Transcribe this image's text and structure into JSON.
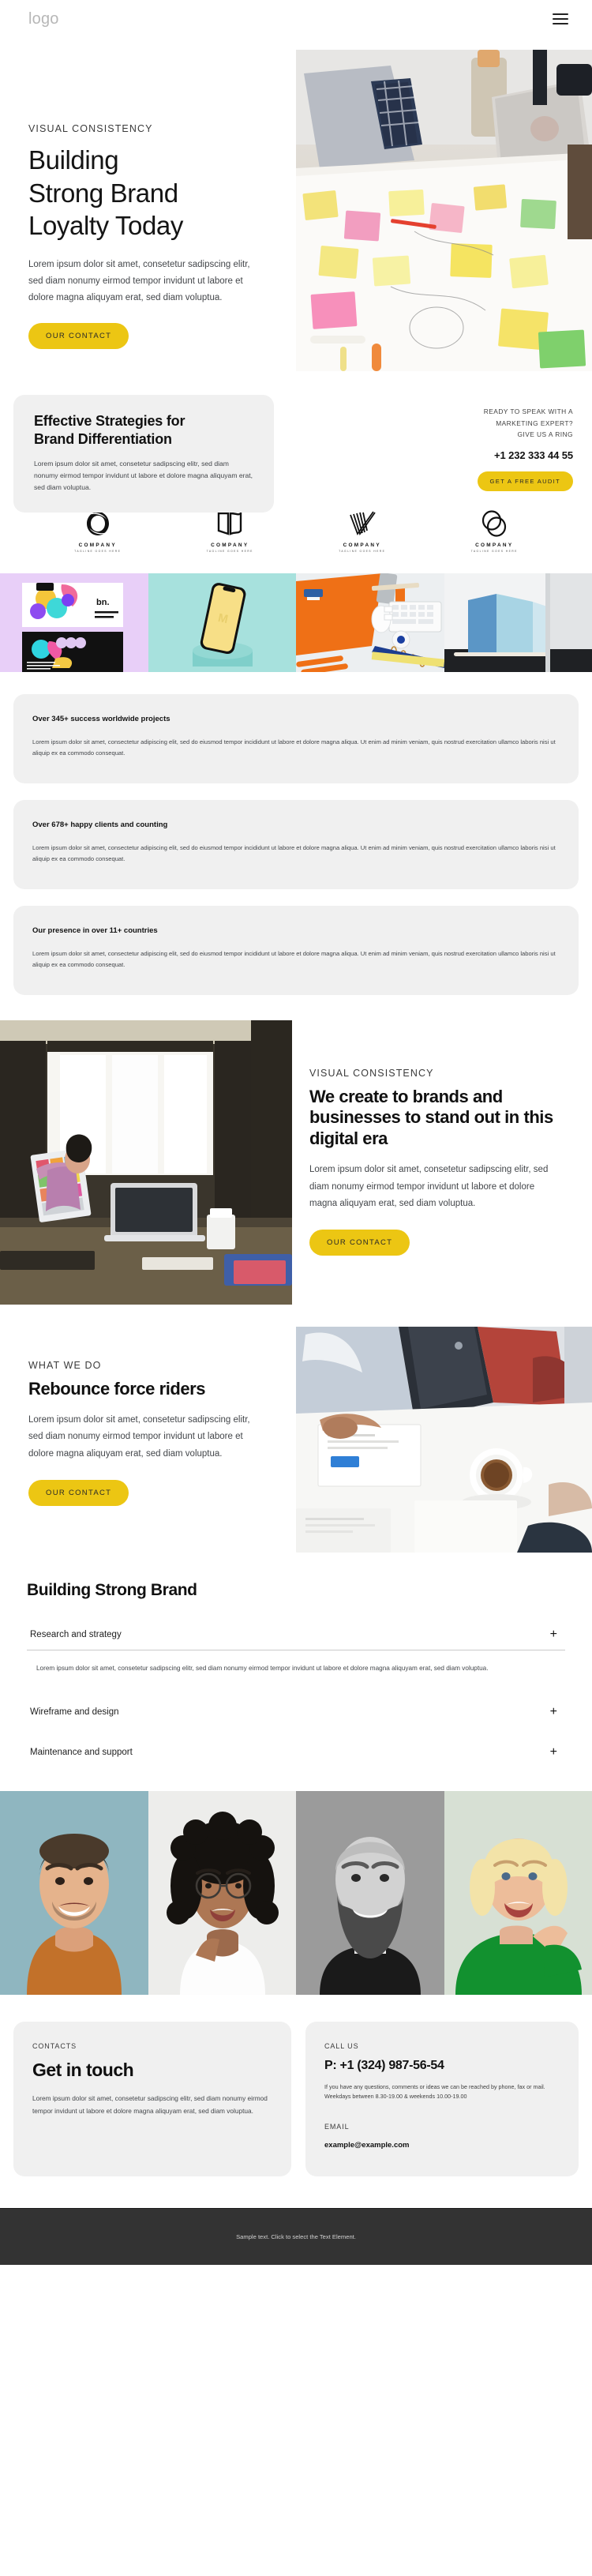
{
  "header": {
    "logo": "logo",
    "menu_icon": "hamburger-menu-icon"
  },
  "hero": {
    "eyebrow": "VISUAL CONSISTENCY",
    "title_line1": "Building",
    "title_line2": "Strong Brand",
    "title_line3": "Loyalty Today",
    "body": "Lorem ipsum dolor sit amet, consetetur sadipscing elitr, sed diam nonumy eirmod tempor invidunt ut labore et dolore magna aliquyam erat, sed diam voluptua.",
    "cta": "OUR CONTACT",
    "image_alt": "team-brainstorming-sticky-notes-photo"
  },
  "strategies": {
    "title_line1": "Effective Strategies for",
    "title_line2": "Brand Differentiation",
    "body": "Lorem ipsum dolor sit amet, consetetur sadipscing elitr, sed diam nonumy eirmod tempor invidunt ut labore et dolore magna aliquyam erat, sed diam voluptua.",
    "side_label_line1": "READY TO SPEAK WITH A",
    "side_label_line2": "MARKETING EXPERT?",
    "side_label_line3": "GIVE US A RING",
    "phone": "+1 232 333 44 55",
    "cta": "GET A FREE AUDIT"
  },
  "clients": [
    {
      "name": "COMPANY",
      "tagline": "TAGLINE GOES HERE",
      "mark": "ring-knot-logo-icon"
    },
    {
      "name": "COMPANY",
      "tagline": "TAGLINE GOES HERE",
      "mark": "open-book-logo-icon"
    },
    {
      "name": "COMPANY",
      "tagline": "TAGLINE GOES HERE",
      "mark": "checkmark-stripes-logo-icon"
    },
    {
      "name": "COMPANY",
      "tagline": "TAGLINE GOES HERE",
      "mark": "overlapping-ovals-logo-icon"
    }
  ],
  "gallery": [
    {
      "alt": "branding-stationery-lilac-photo"
    },
    {
      "alt": "phone-mockup-mint-pedestal-photo"
    },
    {
      "alt": "orange-desk-flatlay-photo"
    },
    {
      "alt": "blue-paper-cards-photo"
    }
  ],
  "stats": [
    {
      "title": "Over 345+ success worldwide projects",
      "body": "Lorem ipsum dolor sit amet, consectetur adipiscing elit, sed do eiusmod tempor incididunt ut labore et dolore magna aliqua. Ut enim ad minim veniam, quis nostrud exercitation ullamco laboris nisi ut aliquip ex ea commodo consequat."
    },
    {
      "title": "Over 678+ happy clients and counting",
      "body": "Lorem ipsum dolor sit amet, consectetur adipiscing elit, sed do eiusmod tempor incididunt ut labore et dolore magna aliqua. Ut enim ad minim veniam, quis nostrud exercitation ullamco laboris nisi ut aliquip ex ea commodo consequat."
    },
    {
      "title": "Our presence in over 11+ countries",
      "body": "Lorem ipsum dolor sit amet, consectetur adipiscing elit, sed do eiusmod tempor incididunt ut labore et dolore magna aliqua. Ut enim ad minim veniam, quis nostrud exercitation ullamco laboris nisi ut aliquip ex ea commodo consequat."
    }
  ],
  "feature_one": {
    "eyebrow": "VISUAL CONSISTENCY",
    "title": "We create to brands and businesses to stand out in this digital era",
    "body": "Lorem ipsum dolor sit amet, consetetur sadipscing elitr, sed diam nonumy eirmod tempor invidunt ut labore et dolore magna aliquyam erat, sed diam voluptua.",
    "cta": "OUR CONTACT",
    "image_alt": "designer-at-desk-with-color-swatches-photo"
  },
  "feature_two": {
    "eyebrow": "WHAT WE DO",
    "title": "Rebounce force riders",
    "body": "Lorem ipsum dolor sit amet, consetetur sadipscing elitr, sed diam nonumy eirmod tempor invidunt ut labore et dolore magna aliquyam erat, sed diam voluptua.",
    "cta": "OUR CONTACT",
    "image_alt": "business-meeting-coffee-documents-photo"
  },
  "accordion": {
    "heading": "Building Strong Brand",
    "expand_icon": "plus-icon",
    "items": [
      {
        "label": "Research and strategy",
        "expanded": true,
        "body": "Lorem ipsum dolor sit amet, consetetur sadipscing elitr, sed diam nonumy eirmod tempor invidunt ut labore et dolore magna aliquyam erat, sed diam voluptua."
      },
      {
        "label": "Wireframe and design",
        "expanded": false,
        "body": ""
      },
      {
        "label": "Maintenance and support",
        "expanded": false,
        "body": ""
      }
    ]
  },
  "team": [
    {
      "alt": "smiling-man-orange-shirt-photo"
    },
    {
      "alt": "woman-glasses-curly-hair-photo"
    },
    {
      "alt": "bearded-man-grayscale-photo"
    },
    {
      "alt": "blonde-woman-green-sweater-photo"
    }
  ],
  "contact": {
    "left": {
      "eyebrow": "CONTACTS",
      "title": "Get in touch",
      "body": "Lorem ipsum dolor sit amet, consetetur sadipscing elitr, sed diam nonumy eirmod tempor invidunt ut labore et dolore magna aliquyam erat, sed diam voluptua."
    },
    "right": {
      "eyebrow": "CALL US",
      "phone": "P: +1 (324) 987-56-54",
      "note": "If you have any questions, comments or ideas we can be reached by phone, fax or mail. Weekdays between 8.30-19.00 & weekends 10.00-19.00",
      "email_label": "EMAIL",
      "email": "example@example.com"
    }
  },
  "footer": {
    "text": "Sample text. Click to select the Text Element."
  },
  "colors": {
    "accent": "#ecc613",
    "card_bg": "#f0f0f0",
    "footer_bg": "#333333",
    "text": "#1b1b1b"
  }
}
